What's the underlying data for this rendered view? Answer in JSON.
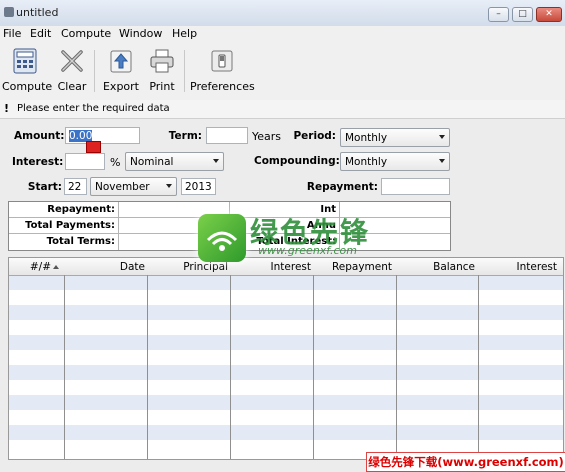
{
  "window": {
    "title": "untitled",
    "minimize_glyph": "–",
    "maximize_glyph": "□",
    "close_glyph": "✕"
  },
  "menu": {
    "file": "File",
    "edit": "Edit",
    "compute": "Compute",
    "window": "Window",
    "help": "Help"
  },
  "toolbar": {
    "compute": "Compute",
    "clear": "Clear",
    "export": "Export",
    "print": "Print",
    "preferences": "Preferences"
  },
  "message": {
    "icon": "!",
    "text": "Please enter the required data"
  },
  "form": {
    "amount_label": "Amount:",
    "amount_value": "0.00",
    "term_label": "Term:",
    "term_value": "",
    "term_unit": "Years",
    "period_label": "Period:",
    "period_value": "Monthly",
    "interest_label": "Interest:",
    "interest_value": "",
    "interest_unit": "%",
    "interest_type_value": "Nominal",
    "compounding_label": "Compounding:",
    "compounding_value": "Monthly",
    "start_label": "Start:",
    "start_day": "22",
    "start_month": "November",
    "start_year": "2013",
    "repayment_label": "Repayment:",
    "repayment_value": ""
  },
  "summary": {
    "repayment_label": "Repayment:",
    "total_payments_label": "Total Payments:",
    "total_terms_label": "Total Terms:",
    "col2_row1_label": "Int",
    "col2_row2_label": "Annu",
    "col2_row3_label": "Total Interest:"
  },
  "table": {
    "headers": [
      "#/#",
      "Date",
      "Principal",
      "Interest",
      "Repayment",
      "Balance",
      "Interest"
    ]
  },
  "watermark": {
    "brand": "绿色先锋",
    "url": "www.greenxf.com",
    "logo_text": "GREENXF.COM",
    "footer": "绿色先锋下载(www.greenxf.com)"
  },
  "colors": {
    "row_alt": "#e3eaf6",
    "accent": "#2f8f3a"
  }
}
